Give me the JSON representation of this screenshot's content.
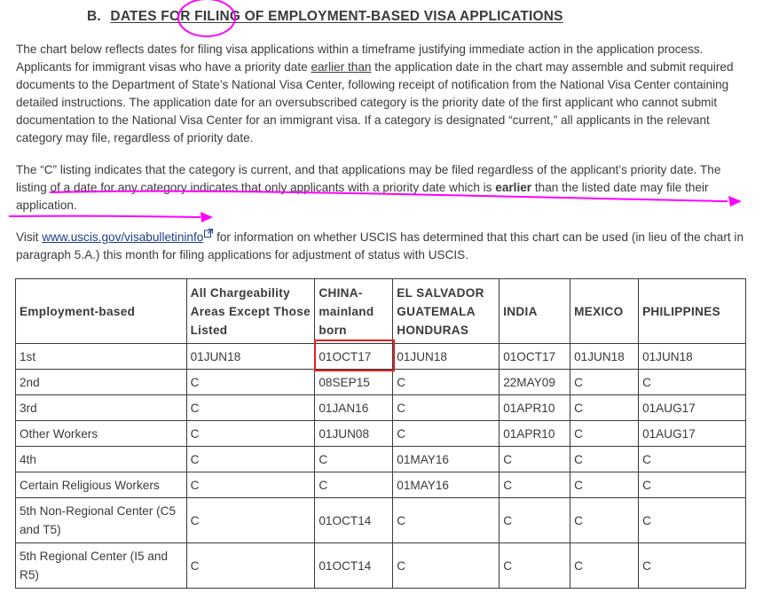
{
  "heading": {
    "letter": "B.",
    "title": "DATES FOR FILING OF EMPLOYMENT-BASED VISA APPLICATIONS"
  },
  "paragraph1": {
    "part1": "The chart below reflects dates for filing visa applications within a timeframe justifying immediate action in the application process. Applicants for immigrant visas who have a priority date ",
    "underlined": "earlier than",
    "part2": " the application date in the chart may assemble and submit required documents to the Department of State’s National Visa Center, following receipt of notification from the National Visa Center containing detailed instructions. The application date for an oversubscribed category is the priority date of the first applicant who cannot submit documentation to the National Visa Center for an immigrant visa. If a category is designated “current,” all applicants in the relevant category may file, regardless of priority date."
  },
  "paragraph2": {
    "part1": "The “C” listing indicates that the category is current, and that applications may be filed regardless of the applicant’s priority date. The listing of a date for any category indicates that only applicants with a priority date which is ",
    "bold": "earlier",
    "part2": " than the listed date may file their application."
  },
  "paragraph3": {
    "before": "Visit ",
    "link": "www.uscis.gov/visabulletininfo",
    "after": " for information on whether USCIS has determined that this chart can be used (in lieu of the chart in paragraph 5.A.) this month for filing applications for adjustment of status with USCIS."
  },
  "table": {
    "headers": [
      "Employment-based",
      "All Chargeability Areas Except Those Listed",
      "CHINA-mainland born",
      "EL SALVADOR GUATEMALA HONDURAS",
      "INDIA",
      "MEXICO",
      "PHILIPPINES"
    ],
    "rows": [
      [
        "1st",
        "01JUN18",
        "01OCT17",
        "01JUN18",
        "01OCT17",
        "01JUN18",
        "01JUN18"
      ],
      [
        "2nd",
        "C",
        "08SEP15",
        "C",
        "22MAY09",
        "C",
        "C"
      ],
      [
        "3rd",
        "C",
        "01JAN16",
        "C",
        "01APR10",
        "C",
        "01AUG17"
      ],
      [
        "Other Workers",
        "C",
        "01JUN08",
        "C",
        "01APR10",
        "C",
        "01AUG17"
      ],
      [
        "4th",
        "C",
        "C",
        "01MAY16",
        "C",
        "C",
        "C"
      ],
      [
        "Certain Religious Workers",
        "C",
        "C",
        "01MAY16",
        "C",
        "C",
        "C"
      ],
      [
        "5th Non-Regional Center (C5 and T5)",
        "C",
        "01OCT14",
        "C",
        "C",
        "C",
        "C"
      ],
      [
        "5th Regional Center (I5 and R5)",
        "C",
        "01OCT14",
        "C",
        "C",
        "C",
        "C"
      ]
    ]
  },
  "annotations": {
    "color_magenta": "#ff00ff",
    "color_red": "#e02020"
  }
}
